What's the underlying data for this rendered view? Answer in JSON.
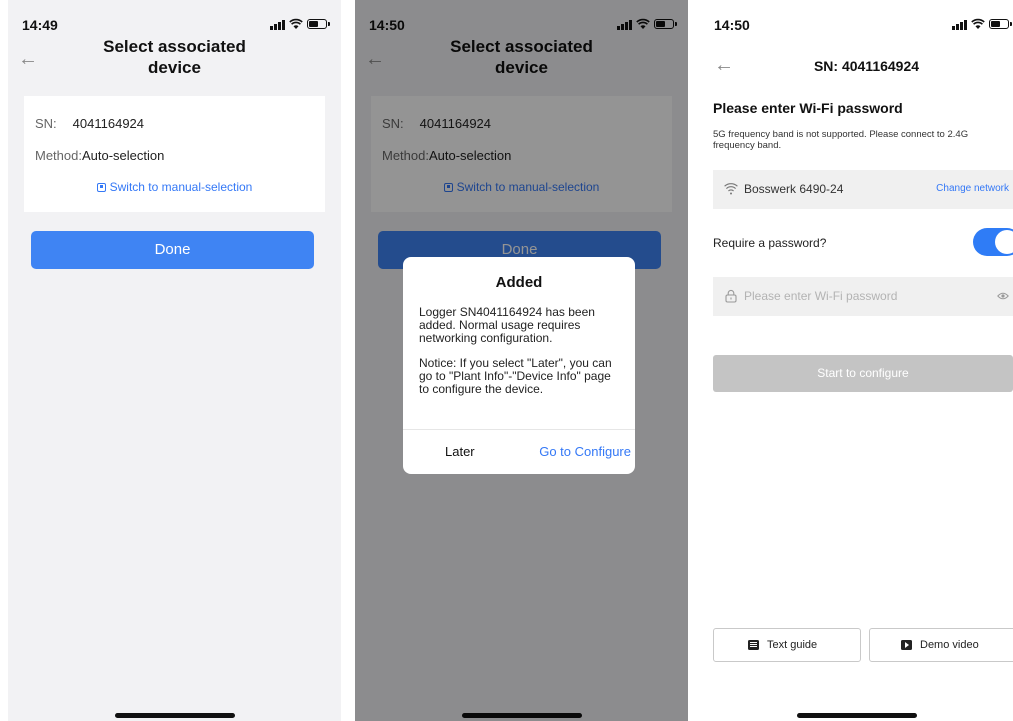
{
  "screen1": {
    "status": {
      "time": "14:49"
    },
    "title": "Select associated device",
    "back_icon": "arrow-left-icon",
    "sn_label": "SN:",
    "sn_value": "4041164924",
    "method_label": "Method:",
    "method_value": "Auto-selection",
    "switch_link": "Switch to manual-selection",
    "done_button": "Done"
  },
  "screen2": {
    "status": {
      "time": "14:50"
    },
    "title": "Select associated device",
    "sn_label": "SN:",
    "sn_value": "4041164924",
    "method_label": "Method:",
    "method_value": "Auto-selection",
    "switch_link": "Switch to manual-selection",
    "done_button": "Done",
    "dialog": {
      "title": "Added",
      "message": "Logger SN4041164924 has been added. Normal usage requires networking configuration.",
      "notice": "Notice: If you select \"Later\", you can go to \"Plant Info\"-\"Device Info\" page to configure the device.",
      "later_button": "Later",
      "configure_button": "Go to Configure"
    }
  },
  "screen3": {
    "status": {
      "time": "14:50"
    },
    "title": "SN: 4041164924",
    "heading": "Please enter Wi-Fi password",
    "note": "5G frequency band is not supported. Please connect to 2.4G frequency band.",
    "network_name": "Bosswerk 6490-24",
    "change_network": "Change network",
    "require_password_label": "Require a password?",
    "require_password_on": true,
    "password": {
      "value": "",
      "placeholder": "Please enter Wi-Fi password"
    },
    "start_button": "Start to configure",
    "text_guide_button": "Text guide",
    "demo_video_button": "Demo video"
  },
  "colors": {
    "accent": "#3f84f3",
    "link": "#3478f6",
    "disabled_button": "#c4c4c4",
    "screen_bg": "#f2f2f4"
  }
}
